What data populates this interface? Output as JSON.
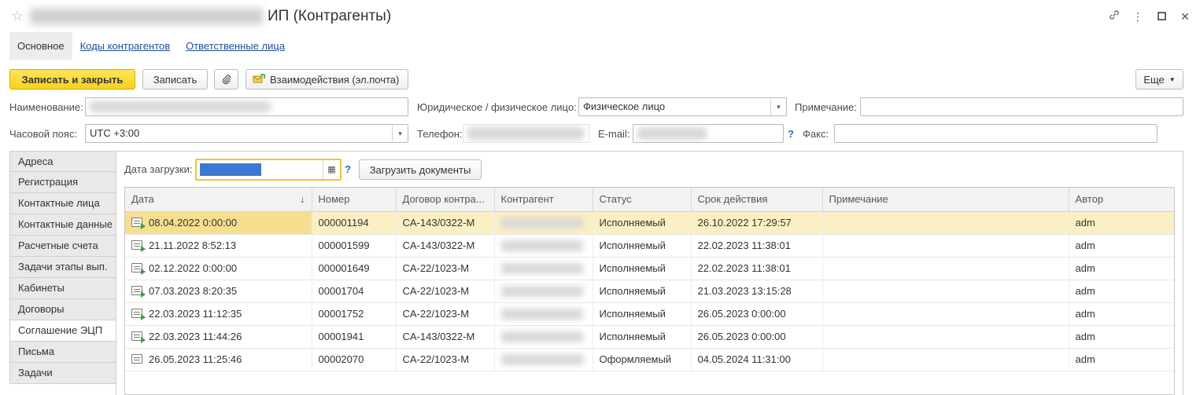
{
  "window": {
    "title": "ИП (Контрагенты)",
    "icons": [
      "link-icon",
      "more-vertical-icon",
      "maximize-icon",
      "close-icon"
    ]
  },
  "nav_tabs": [
    {
      "label": "Основное",
      "active": true
    },
    {
      "label": "Коды контрагентов",
      "active": false
    },
    {
      "label": "Ответственные лица",
      "active": false
    }
  ],
  "toolbar": {
    "save_close": "Записать и закрыть",
    "save": "Записать",
    "interactions": "Взаимодействия (эл.почта)",
    "more": "Еще"
  },
  "form": {
    "name_label": "Наименование:",
    "entity_label": "Юридическое / физическое лицо:",
    "entity_value": "Физическое лицо",
    "note_label": "Примечание:",
    "timezone_label": "Часовой пояс:",
    "timezone_value": "UTC +3:00",
    "phone_label": "Телефон:",
    "email_label": "E-mail:",
    "fax_label": "Факс:",
    "help": "?"
  },
  "side_tabs": [
    "Адреса",
    "Регистрация",
    "Контактные лица",
    "Контактные данные",
    "Расчетные счета",
    "Задачи этапы вып.",
    "Кабинеты",
    "Договоры",
    "Соглашение ЭЦП",
    "Письма",
    "Задачи"
  ],
  "active_side_tab": "Соглашение ЭЦП",
  "load": {
    "date_label": "Дата загрузки:",
    "button": "Загрузить документы",
    "help": "?"
  },
  "table": {
    "columns": [
      "Дата",
      "Номер",
      "Договор контра...",
      "Контрагент",
      "Статус",
      "Срок действия",
      "Примечание",
      "Автор"
    ],
    "rows": [
      {
        "date": "08.04.2022 0:00:00",
        "number": "000001194",
        "contract": "CA-143/0322-M",
        "status": "Исполняемый",
        "valid": "26.10.2022 17:29:57",
        "note": "",
        "author": "adm",
        "icon": "doc-check-icon"
      },
      {
        "date": "21.11.2022 8:52:13",
        "number": "000001599",
        "contract": "CA-143/0322-M",
        "status": "Исполняемый",
        "valid": "22.02.2023 11:38:01",
        "note": "",
        "author": "adm",
        "icon": "doc-check-icon"
      },
      {
        "date": "02.12.2022 0:00:00",
        "number": "000001649",
        "contract": "CA-22/1023-M",
        "status": "Исполняемый",
        "valid": "22.02.2023 11:38:01",
        "note": "",
        "author": "adm",
        "icon": "doc-check-icon"
      },
      {
        "date": "07.03.2023 8:20:35",
        "number": "00001704",
        "contract": "CA-22/1023-M",
        "status": "Исполняемый",
        "valid": "21.03.2023 13:15:28",
        "note": "",
        "author": "adm",
        "icon": "doc-check-icon"
      },
      {
        "date": "22.03.2023 11:12:35",
        "number": "00001752",
        "contract": "CA-22/1023-M",
        "status": "Исполняемый",
        "valid": "26.05.2023 0:00:00",
        "note": "",
        "author": "adm",
        "icon": "doc-check-icon"
      },
      {
        "date": "22.03.2023 11:44:26",
        "number": "00001941",
        "contract": "CA-143/0322-M",
        "status": "Исполняемый",
        "valid": "26.05.2023 0:00:00",
        "note": "",
        "author": "adm",
        "icon": "doc-check-icon"
      },
      {
        "date": "26.05.2023 11:25:46",
        "number": "00002070",
        "contract": "CA-22/1023-M",
        "status": "Оформляемый",
        "valid": "04.05.2024 11:31:00",
        "note": "",
        "author": "adm",
        "icon": "doc-icon"
      }
    ]
  },
  "colors": {
    "primary_button": "#f7d21f",
    "selected_row": "#fbefc4",
    "link": "#1d4f9c",
    "focus_border": "#f0c536"
  }
}
